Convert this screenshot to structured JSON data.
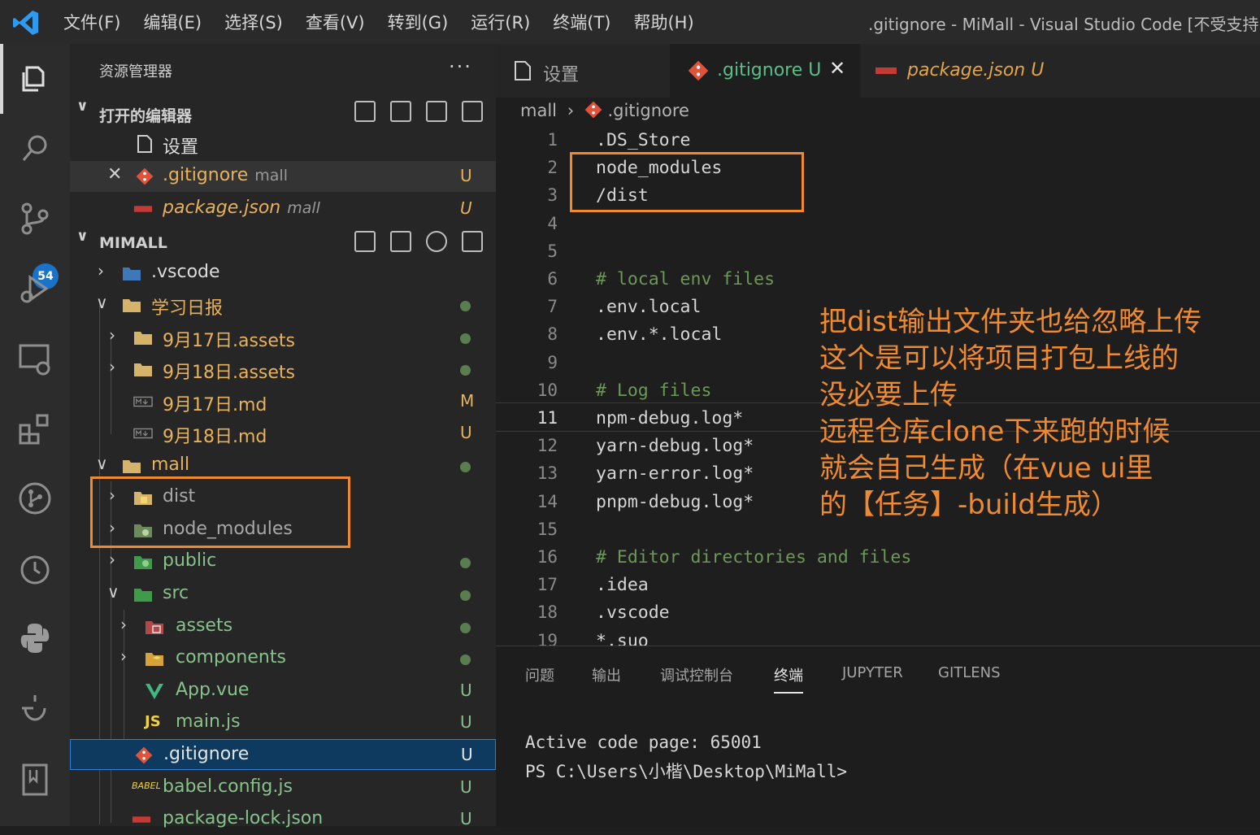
{
  "titlebar": {
    "menu": [
      "文件(F)",
      "编辑(E)",
      "选择(S)",
      "查看(V)",
      "转到(G)",
      "运行(R)",
      "终端(T)",
      "帮助(H)"
    ],
    "window_title": ".gitignore - MiMall - Visual Studio Code [不受支持"
  },
  "activity": {
    "scm_badge": "54"
  },
  "sidebar": {
    "title": "资源管理器",
    "more": "···",
    "open_editors": {
      "label": "打开的编辑器",
      "items": [
        {
          "name": "设置",
          "dir": "",
          "status": ""
        },
        {
          "name": ".gitignore",
          "dir": "mall",
          "status": "U"
        },
        {
          "name": "package.json",
          "dir": "mall",
          "status": "U"
        }
      ]
    },
    "workspace": {
      "label": "MIMALL",
      "items": [
        {
          "name": ".vscode",
          "status": ""
        },
        {
          "name": "学习日报",
          "status": ""
        },
        {
          "name": "9月17日.assets",
          "status": ""
        },
        {
          "name": "9月18日.assets",
          "status": ""
        },
        {
          "name": "9月17日.md",
          "status": "M"
        },
        {
          "name": "9月18日.md",
          "status": "U"
        },
        {
          "name": "mall",
          "status": ""
        },
        {
          "name": "dist",
          "status": ""
        },
        {
          "name": "node_modules",
          "status": ""
        },
        {
          "name": "public",
          "status": ""
        },
        {
          "name": "src",
          "status": ""
        },
        {
          "name": "assets",
          "status": ""
        },
        {
          "name": "components",
          "status": ""
        },
        {
          "name": "App.vue",
          "status": "U"
        },
        {
          "name": "main.js",
          "status": "U"
        },
        {
          "name": ".gitignore",
          "status": "U"
        },
        {
          "name": "babel.config.js",
          "status": "U"
        },
        {
          "name": "package-lock.json",
          "status": "U"
        }
      ]
    }
  },
  "editor": {
    "tabs": [
      {
        "label": "设置",
        "status": ""
      },
      {
        "label": ".gitignore",
        "status": "U"
      },
      {
        "label": "package.json",
        "status": "U"
      }
    ],
    "breadcrumb": [
      "mall",
      ".gitignore"
    ],
    "lines": [
      {
        "n": "1",
        "text": ".DS_Store",
        "comment": false
      },
      {
        "n": "2",
        "text": "node_modules",
        "comment": false
      },
      {
        "n": "3",
        "text": "/dist",
        "comment": false
      },
      {
        "n": "4",
        "text": "",
        "comment": false
      },
      {
        "n": "5",
        "text": "",
        "comment": false
      },
      {
        "n": "6",
        "text": "# local env files",
        "comment": true
      },
      {
        "n": "7",
        "text": ".env.local",
        "comment": false
      },
      {
        "n": "8",
        "text": ".env.*.local",
        "comment": false
      },
      {
        "n": "9",
        "text": "",
        "comment": false
      },
      {
        "n": "10",
        "text": "# Log files",
        "comment": true
      },
      {
        "n": "11",
        "text": "npm-debug.log*",
        "comment": false
      },
      {
        "n": "12",
        "text": "yarn-debug.log*",
        "comment": false
      },
      {
        "n": "13",
        "text": "yarn-error.log*",
        "comment": false
      },
      {
        "n": "14",
        "text": "pnpm-debug.log*",
        "comment": false
      },
      {
        "n": "15",
        "text": "",
        "comment": false
      },
      {
        "n": "16",
        "text": "# Editor directories and files",
        "comment": true
      },
      {
        "n": "17",
        "text": ".idea",
        "comment": false
      },
      {
        "n": "18",
        "text": ".vscode",
        "comment": false
      },
      {
        "n": "19",
        "text": "*.suo",
        "comment": false
      }
    ]
  },
  "panel": {
    "tabs": [
      "问题",
      "输出",
      "调试控制台",
      "终端",
      "JUPYTER",
      "GITLENS"
    ],
    "active_tab": "终端",
    "terminal": [
      "Active code page: 65001",
      "PS C:\\Users\\小楷\\Desktop\\MiMall>"
    ]
  },
  "annotation": {
    "lines": [
      "把dist输出文件夹也给忽略上传",
      "这个是可以将项目打包上线的",
      "没必要上传",
      "远程仓库clone下来跑的时候",
      "就会自己生成（在vue ui里",
      "的【任务】-build生成）"
    ],
    "color": "#f08a2e"
  }
}
